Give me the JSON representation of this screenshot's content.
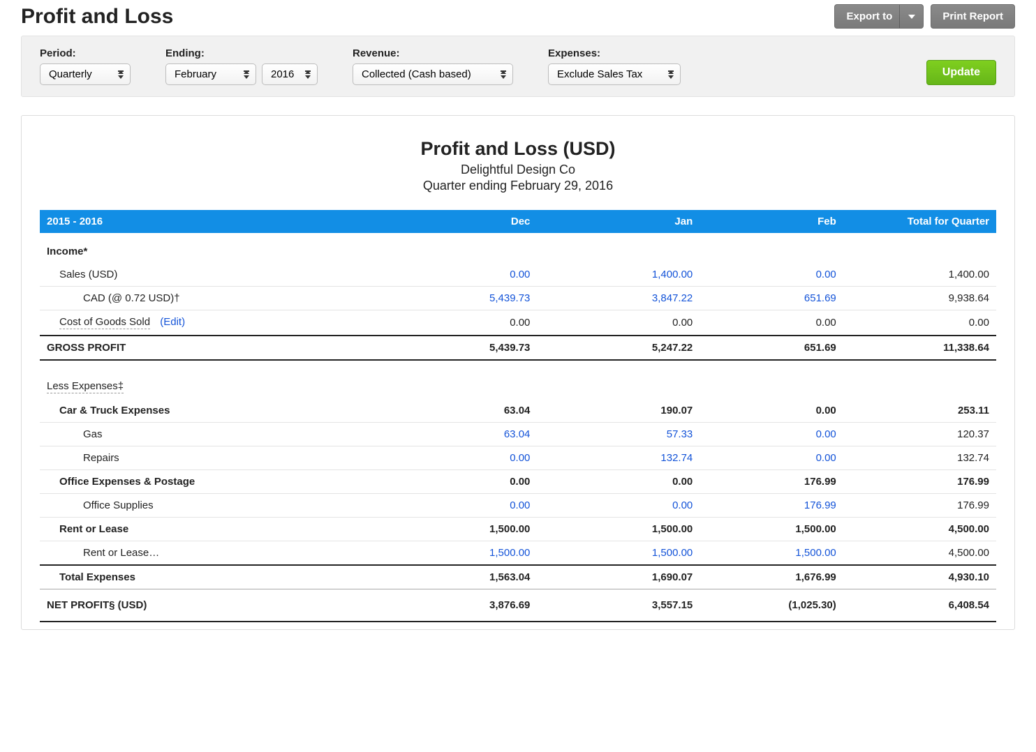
{
  "header": {
    "title": "Profit and Loss",
    "export_label": "Export to",
    "print_label": "Print Report"
  },
  "filters": {
    "period_label": "Period:",
    "period_value": "Quarterly",
    "ending_label": "Ending:",
    "ending_month": "February",
    "ending_year": "2016",
    "revenue_label": "Revenue:",
    "revenue_value": "Collected (Cash based)",
    "expenses_label": "Expenses:",
    "expenses_value": "Exclude Sales Tax",
    "update_label": "Update"
  },
  "report": {
    "title": "Profit and Loss (USD)",
    "company": "Delightful Design Co",
    "subtitle": "Quarter ending February 29, 2016",
    "columns": {
      "range": "2015 - 2016",
      "c1": "Dec",
      "c2": "Jan",
      "c3": "Feb",
      "c4": "Total for Quarter"
    },
    "rows": {
      "income_header": "Income*",
      "sales_label": "Sales (USD)",
      "sales": {
        "dec": "0.00",
        "jan": "1,400.00",
        "feb": "0.00",
        "tot": "1,400.00"
      },
      "cad_label": "CAD (@ 0.72 USD)†",
      "cad": {
        "dec": "5,439.73",
        "jan": "3,847.22",
        "feb": "651.69",
        "tot": "9,938.64"
      },
      "cogs_label": "Cost of Goods Sold",
      "cogs_edit": "(Edit)",
      "cogs": {
        "dec": "0.00",
        "jan": "0.00",
        "feb": "0.00",
        "tot": "0.00"
      },
      "gross_label": "GROSS PROFIT",
      "gross": {
        "dec": "5,439.73",
        "jan": "5,247.22",
        "feb": "651.69",
        "tot": "11,338.64"
      },
      "less_exp_header": "Less Expenses‡",
      "car_label": "Car & Truck Expenses",
      "car": {
        "dec": "63.04",
        "jan": "190.07",
        "feb": "0.00",
        "tot": "253.11"
      },
      "gas_label": "Gas",
      "gas": {
        "dec": "63.04",
        "jan": "57.33",
        "feb": "0.00",
        "tot": "120.37"
      },
      "repairs_label": "Repairs",
      "repairs": {
        "dec": "0.00",
        "jan": "132.74",
        "feb": "0.00",
        "tot": "132.74"
      },
      "office_label": "Office Expenses & Postage",
      "office": {
        "dec": "0.00",
        "jan": "0.00",
        "feb": "176.99",
        "tot": "176.99"
      },
      "supplies_label": "Office Supplies",
      "supplies": {
        "dec": "0.00",
        "jan": "0.00",
        "feb": "176.99",
        "tot": "176.99"
      },
      "rent_label": "Rent or Lease",
      "rent": {
        "dec": "1,500.00",
        "jan": "1,500.00",
        "feb": "1,500.00",
        "tot": "4,500.00"
      },
      "rent_sub_label": "Rent or Lease…",
      "rent_sub": {
        "dec": "1,500.00",
        "jan": "1,500.00",
        "feb": "1,500.00",
        "tot": "4,500.00"
      },
      "total_exp_label": "Total Expenses",
      "total_exp": {
        "dec": "1,563.04",
        "jan": "1,690.07",
        "feb": "1,676.99",
        "tot": "4,930.10"
      },
      "net_label": "NET PROFIT§ (USD)",
      "net": {
        "dec": "3,876.69",
        "jan": "3,557.15",
        "feb": "(1,025.30)",
        "tot": "6,408.54"
      }
    }
  }
}
